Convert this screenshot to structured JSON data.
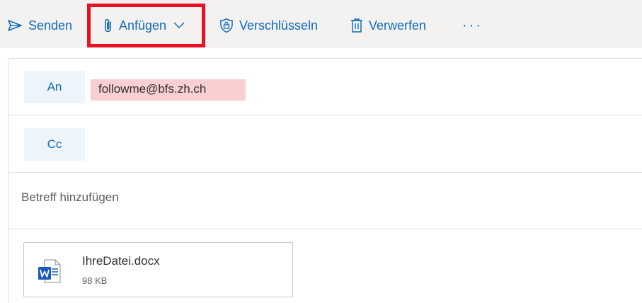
{
  "toolbar": {
    "send_label": "Senden",
    "attach_label": "Anfügen",
    "encrypt_label": "Verschlüsseln",
    "discard_label": "Verwerfen",
    "more_label": "···",
    "icons": {
      "send": "send-icon",
      "attach": "paperclip-icon",
      "attach_dropdown": "chevron-down-icon",
      "encrypt": "shield-lock-icon",
      "discard": "trash-icon"
    }
  },
  "compose": {
    "to_label": "An",
    "to_recipient": "followme@bfs.zh.ch",
    "cc_label": "Cc",
    "subject_placeholder": "Betreff hinzufügen",
    "attachment": {
      "name": "IhreDatei.docx",
      "size": "98 KB",
      "icon": "word-document-icon"
    }
  },
  "colors": {
    "accent": "#0f6cbd",
    "toolbar_bg": "#f3f2f1",
    "label_bg": "#edf4fb",
    "recipient_highlight": "#f9cfd1",
    "annotation_box": "#e81123",
    "word_blue": "#185abd"
  }
}
